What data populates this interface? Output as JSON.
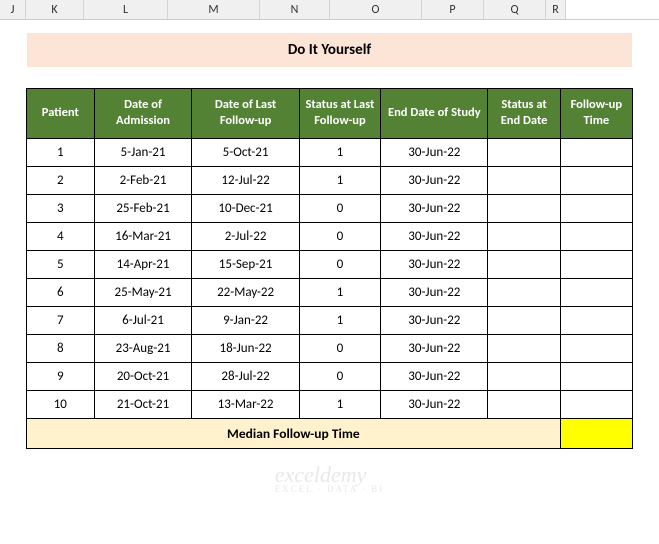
{
  "columns": [
    "J",
    "K",
    "L",
    "M",
    "N",
    "O",
    "P",
    "Q",
    "R"
  ],
  "title": "Do It Yourself",
  "headers": {
    "patient": "Patient",
    "admission": "Date of Admission",
    "lastFollow": "Date of Last Follow-up",
    "statusLast": "Status at Last Follow-up",
    "endDate": "End Date of Study",
    "statusEnd": "Status at End Date",
    "followTime": "Follow-up Time"
  },
  "rows": [
    {
      "patient": "1",
      "admission": "5-Jan-21",
      "lastFollow": "5-Oct-21",
      "statusLast": "1",
      "endDate": "30-Jun-22",
      "statusEnd": "",
      "followTime": ""
    },
    {
      "patient": "2",
      "admission": "2-Feb-21",
      "lastFollow": "12-Jul-22",
      "statusLast": "1",
      "endDate": "30-Jun-22",
      "statusEnd": "",
      "followTime": ""
    },
    {
      "patient": "3",
      "admission": "25-Feb-21",
      "lastFollow": "10-Dec-21",
      "statusLast": "0",
      "endDate": "30-Jun-22",
      "statusEnd": "",
      "followTime": ""
    },
    {
      "patient": "4",
      "admission": "16-Mar-21",
      "lastFollow": "2-Jul-22",
      "statusLast": "0",
      "endDate": "30-Jun-22",
      "statusEnd": "",
      "followTime": ""
    },
    {
      "patient": "5",
      "admission": "14-Apr-21",
      "lastFollow": "15-Sep-21",
      "statusLast": "0",
      "endDate": "30-Jun-22",
      "statusEnd": "",
      "followTime": ""
    },
    {
      "patient": "6",
      "admission": "25-May-21",
      "lastFollow": "22-May-22",
      "statusLast": "1",
      "endDate": "30-Jun-22",
      "statusEnd": "",
      "followTime": ""
    },
    {
      "patient": "7",
      "admission": "6-Jul-21",
      "lastFollow": "9-Jan-22",
      "statusLast": "1",
      "endDate": "30-Jun-22",
      "statusEnd": "",
      "followTime": ""
    },
    {
      "patient": "8",
      "admission": "23-Aug-21",
      "lastFollow": "18-Jun-22",
      "statusLast": "0",
      "endDate": "30-Jun-22",
      "statusEnd": "",
      "followTime": ""
    },
    {
      "patient": "9",
      "admission": "20-Oct-21",
      "lastFollow": "28-Jul-22",
      "statusLast": "0",
      "endDate": "30-Jun-22",
      "statusEnd": "",
      "followTime": ""
    },
    {
      "patient": "10",
      "admission": "21-Oct-21",
      "lastFollow": "13-Mar-22",
      "statusLast": "1",
      "endDate": "30-Jun-22",
      "statusEnd": "",
      "followTime": ""
    }
  ],
  "medianLabel": "Median Follow-up Time",
  "medianValue": "",
  "watermark": {
    "main": "exceldemy",
    "sub": "EXCEL · DATA · BI"
  }
}
